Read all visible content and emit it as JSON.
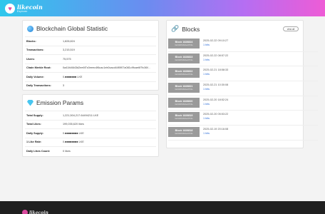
{
  "brand": {
    "name": "likecoin",
    "tagline": "Explorer",
    "heart_glyph": "♥"
  },
  "statistic": {
    "title": "Blockchain Global Statistic",
    "rows": [
      {
        "label": "Blocks:",
        "value": "1,828,824"
      },
      {
        "label": "Transactions:",
        "value": "3,215,519"
      },
      {
        "label": "Users:",
        "value": "75,575"
      },
      {
        "label": "Chain Merkle Root:",
        "value": "0a41fd4643d2ee6f7c0eeec4f6cac1eb0cacd44f0f07a081c9fcae6f7fc36f..."
      },
      {
        "label": "Daily Volume:",
        "value": "0.■■■■■■■ LKE"
      },
      {
        "label": "Daily Transactions:",
        "value": "3"
      }
    ]
  },
  "emission": {
    "title": "Emission Params",
    "rows": [
      {
        "label": "Total Supply:",
        "value": "1,221,504,217.64494211 LKE"
      },
      {
        "label": "Total Likes:",
        "value": "199,035,620 likes"
      },
      {
        "label": "Daily Supply:",
        "value": "0.■■■■■■■■ LKE"
      },
      {
        "label": "1 Like Rate:",
        "value": "0.■■■■■■■■ LKE"
      },
      {
        "label": "Daily Likes Count:",
        "value": "0 likes"
      }
    ]
  },
  "blocks": {
    "title": "Blocks",
    "view_all_label": "view all",
    "items": [
      {
        "name": "Block 1828824",
        "hash": "0a41fd4643d2ee6f7c0e",
        "date": "2025-02-22 09:10:27",
        "likes": "1 bits"
      },
      {
        "name": "Block 1828823",
        "hash": "0a41fd4643d2ee6f7c0e",
        "date": "2025-02-22 08:57:22",
        "likes": "1 bits"
      },
      {
        "name": "Block 1828822",
        "hash": "0a41fd4643d2ee6f7c0e",
        "date": "2025-02-21 18:58:33",
        "likes": "1 bits"
      },
      {
        "name": "Block 1828821",
        "hash": "0a41fd4643d2ee6f7c0e",
        "date": "2025-02-21 10:30:08",
        "likes": "1 bits"
      },
      {
        "name": "Block 1828820",
        "hash": "0a41fd4643d2ee6f7c0e",
        "date": "2025-02-20 18:52:24",
        "likes": "1 bits"
      },
      {
        "name": "Block 1828819",
        "hash": "0a41fd4643d2ee6f7c0e",
        "date": "2025-02-20 05:53:22",
        "likes": "1 bits"
      },
      {
        "name": "Block 1828818",
        "hash": "0a41fd4643d2ee6f7c0e",
        "date": "2025-02-19 20:16:08",
        "likes": "1 bits"
      }
    ]
  },
  "footer": {
    "brand": "likecoin"
  }
}
